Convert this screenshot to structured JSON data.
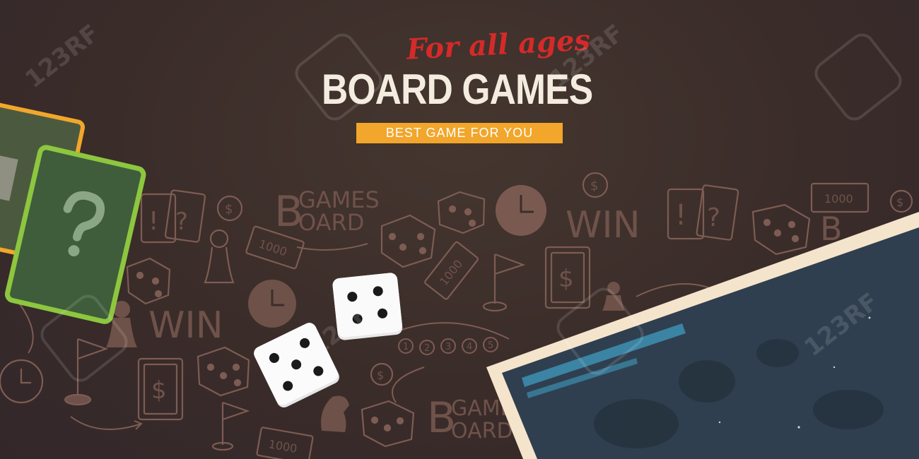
{
  "banner": {
    "tagline": "For all ages",
    "title": "BOARD GAMES",
    "subtitle": "BEST GAME FOR YOU"
  },
  "doodles": {
    "board_games_word_1": [
      "B",
      "GAMES",
      "OARD"
    ],
    "board_games_word_2": [
      "B",
      "GAME",
      "OARD"
    ],
    "win_labels": [
      "WIN",
      "WIN"
    ],
    "money_values": [
      "1000",
      "1000",
      "1000",
      "1000"
    ],
    "path_numbers": [
      "1",
      "2",
      "3",
      "4",
      "5"
    ]
  },
  "dice": [
    {
      "name": "dice-four",
      "pips": 4
    },
    {
      "name": "dice-five",
      "pips": 5
    }
  ],
  "watermark": {
    "text": "123RF"
  },
  "colors": {
    "background": "#3b2e2b",
    "doodle": "#7d5c53",
    "tagline": "#d42a2a",
    "title": "#f5ece0",
    "subtitle_bg": "#f2a62b",
    "card_green": "#3f5d3a",
    "card_border": "#8dc63f",
    "board_frame": "#f5e4cc",
    "board_surface": "#2f3f4f",
    "board_stripe": "#3b84a3"
  },
  "icons": [
    "question-mark-icon",
    "exclamation-icon",
    "dollar-card-icon",
    "clock-icon",
    "flag-icon",
    "pawn-icon",
    "knight-icon",
    "coin-icon"
  ]
}
